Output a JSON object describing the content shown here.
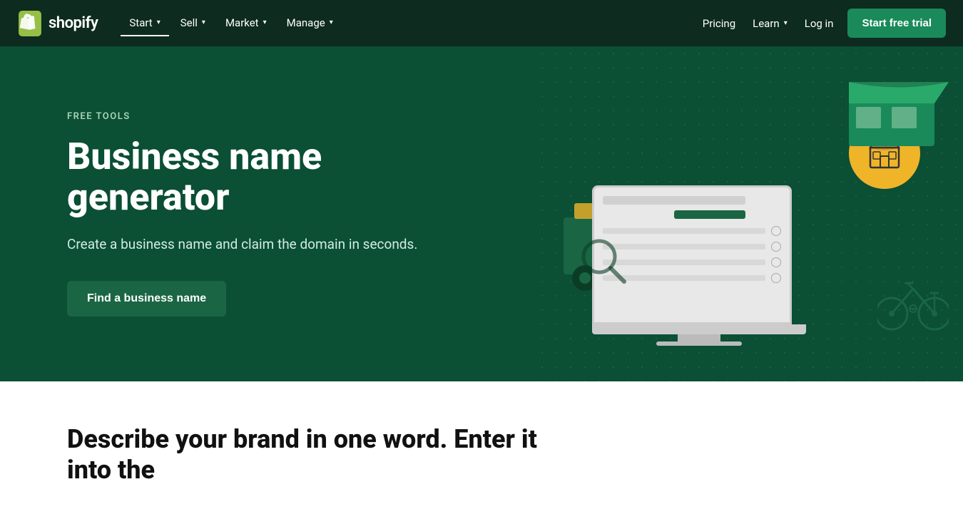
{
  "nav": {
    "logo_text": "shopify",
    "items": [
      {
        "label": "Start",
        "active": true,
        "has_dropdown": true
      },
      {
        "label": "Sell",
        "active": false,
        "has_dropdown": true
      },
      {
        "label": "Market",
        "active": false,
        "has_dropdown": true
      },
      {
        "label": "Manage",
        "active": false,
        "has_dropdown": true
      }
    ],
    "right_items": [
      {
        "label": "Pricing",
        "has_dropdown": false
      },
      {
        "label": "Learn",
        "has_dropdown": true
      },
      {
        "label": "Log in",
        "has_dropdown": false
      }
    ],
    "cta_label": "Start free trial"
  },
  "hero": {
    "label": "FREE TOOLS",
    "title": "Business name generator",
    "subtitle": "Create a business name and claim the domain in seconds.",
    "cta_label": "Find a business name"
  },
  "below": {
    "title": "Describe your brand in one word. Enter it into the"
  }
}
